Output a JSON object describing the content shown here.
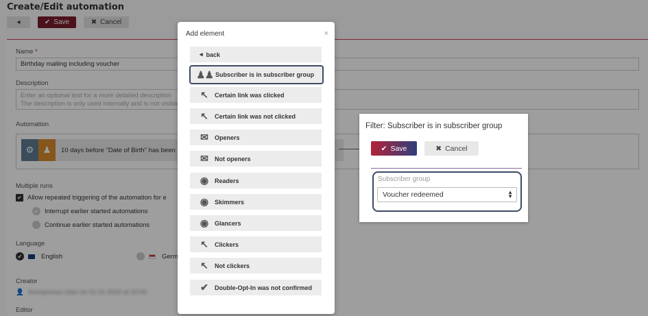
{
  "page": {
    "title": "Create/Edit automation",
    "save_label": "Save",
    "cancel_label": "Cancel"
  },
  "form": {
    "name_label": "Name",
    "name_required": "*",
    "name_value": "Birthday mailing including voucher",
    "description_label": "Description",
    "description_placeholder_line1": "Enter an optional text for a more detailed description",
    "description_placeholder_line2": "The description is only used internally and is not visible",
    "automation_label": "Automation",
    "automation_step_text": "10 days before \"Date of Birth\" has been",
    "multiple_runs_label": "Multiple runs",
    "allow_repeated": "Allow repeated triggering of the automation for e",
    "interrupt": "Interrupt earlier started automations",
    "continue": "Continue earlier started automations",
    "language_label": "Language",
    "lang_english": "English",
    "lang_german": "Germa",
    "creator_label": "Creator",
    "creator_value": "Anonymous User on 01.01.2024 at 10:00",
    "editor_label": "Editor"
  },
  "add_element_modal": {
    "title": "Add element",
    "close": "×",
    "back_label": "back",
    "options": [
      {
        "label": "Subscriber is in subscriber group",
        "icon": "users-icon",
        "selected": true
      },
      {
        "label": "Certain link was clicked",
        "icon": "cursor-link-icon"
      },
      {
        "label": "Certain link was not clicked",
        "icon": "cursor-link-not-icon"
      },
      {
        "label": "Openers",
        "icon": "envelope-open-icon"
      },
      {
        "label": "Not openers",
        "icon": "envelope-not-icon"
      },
      {
        "label": "Readers",
        "icon": "eye-icon"
      },
      {
        "label": "Skimmers",
        "icon": "eye-skim-icon"
      },
      {
        "label": "Glancers",
        "icon": "eye-glance-icon"
      },
      {
        "label": "Clickers",
        "icon": "cursor-icon"
      },
      {
        "label": "Not clickers",
        "icon": "cursor-not-icon"
      },
      {
        "label": "Double-Opt-In was not confirmed",
        "icon": "check-not-icon"
      }
    ]
  },
  "filter_dialog": {
    "title": "Filter: Subscriber is in subscriber group",
    "save_label": "Save",
    "cancel_label": "Cancel",
    "group_label": "Subscriber group",
    "group_value": "Voucher redeemed"
  },
  "colors": {
    "accent": "#c9405a",
    "save_gradient_start": "#b4223a",
    "save_gradient_end": "#2e3f7a",
    "focus_border": "#3d4a66"
  }
}
